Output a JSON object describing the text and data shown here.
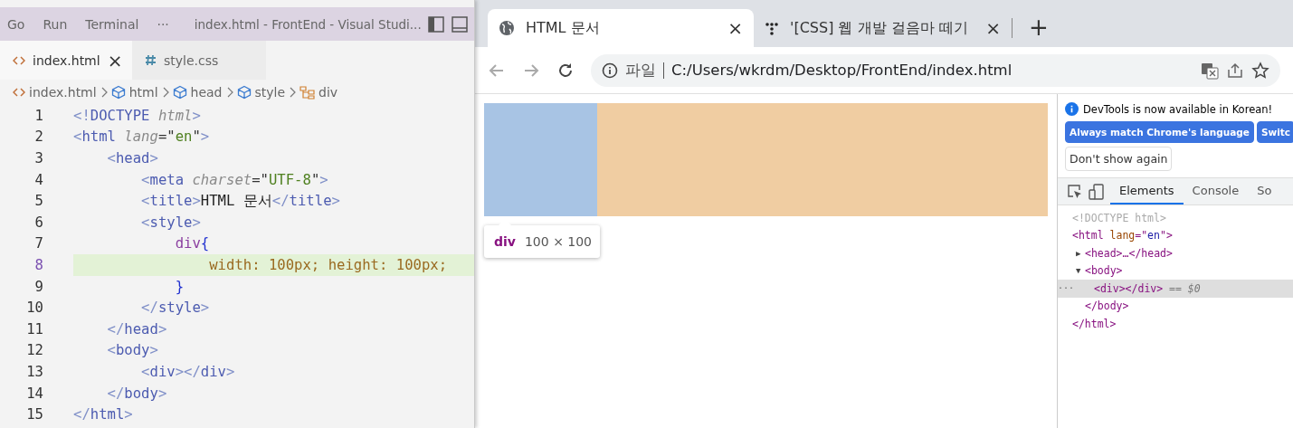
{
  "editor": {
    "menus": [
      "Go",
      "Run",
      "Terminal",
      "···"
    ],
    "title": "index.html - FrontEnd - Visual Studi...",
    "tabs": [
      {
        "label": "index.html",
        "kind": "html",
        "selected": true,
        "close": "×"
      },
      {
        "label": "style.css",
        "kind": "css",
        "selected": false
      }
    ],
    "breadcrumb": [
      {
        "label": "index.html",
        "kind": "file"
      },
      {
        "label": "html",
        "kind": "element"
      },
      {
        "label": "head",
        "kind": "element"
      },
      {
        "label": "style",
        "kind": "element"
      },
      {
        "label": "div",
        "kind": "rule"
      }
    ],
    "lines": [
      {
        "number": "1",
        "highlighted": false,
        "tokens": [
          {
            "kind": "punct",
            "text": "<!"
          },
          {
            "kind": "tag",
            "text": "DOCTYPE "
          },
          {
            "kind": "attr",
            "text": "html"
          },
          {
            "kind": "punct",
            "text": ">"
          }
        ]
      },
      {
        "number": "2",
        "highlighted": false,
        "tokens": [
          {
            "kind": "punct",
            "text": "<"
          },
          {
            "kind": "tag",
            "text": "html "
          },
          {
            "kind": "attr",
            "text": "lang"
          },
          {
            "kind": "plain",
            "text": "=\""
          },
          {
            "kind": "string",
            "text": "en"
          },
          {
            "kind": "plain",
            "text": "\""
          },
          {
            "kind": "punct",
            "text": ">"
          }
        ]
      },
      {
        "number": "3",
        "highlighted": false,
        "tokens": [
          {
            "kind": "punct",
            "text": "    <"
          },
          {
            "kind": "tag",
            "text": "head"
          },
          {
            "kind": "punct",
            "text": ">"
          }
        ]
      },
      {
        "number": "4",
        "highlighted": false,
        "tokens": [
          {
            "kind": "punct",
            "text": "        <"
          },
          {
            "kind": "tag",
            "text": "meta "
          },
          {
            "kind": "attr",
            "text": "charset"
          },
          {
            "kind": "plain",
            "text": "=\""
          },
          {
            "kind": "string",
            "text": "UTF-8"
          },
          {
            "kind": "plain",
            "text": "\""
          },
          {
            "kind": "punct",
            "text": ">"
          }
        ]
      },
      {
        "number": "5",
        "highlighted": false,
        "tokens": [
          {
            "kind": "punct",
            "text": "        <"
          },
          {
            "kind": "tag",
            "text": "title"
          },
          {
            "kind": "punct",
            "text": ">"
          },
          {
            "kind": "text",
            "text": "HTML 문서"
          },
          {
            "kind": "punct",
            "text": "</"
          },
          {
            "kind": "tag",
            "text": "title"
          },
          {
            "kind": "punct",
            "text": ">"
          }
        ]
      },
      {
        "number": "6",
        "highlighted": false,
        "tokens": [
          {
            "kind": "punct",
            "text": "        <"
          },
          {
            "kind": "tag",
            "text": "style"
          },
          {
            "kind": "punct",
            "text": ">"
          }
        ]
      },
      {
        "number": "7",
        "highlighted": false,
        "tokens": [
          {
            "kind": "selector",
            "text": "            div"
          },
          {
            "kind": "brace",
            "text": "{"
          }
        ]
      },
      {
        "number": "8",
        "highlighted": true,
        "tokens": [
          {
            "kind": "prop",
            "text": "                width: 100px; height: 100px;"
          }
        ]
      },
      {
        "number": "9",
        "highlighted": false,
        "tokens": [
          {
            "kind": "brace",
            "text": "            }"
          }
        ]
      },
      {
        "number": "10",
        "highlighted": false,
        "tokens": [
          {
            "kind": "punct",
            "text": "        </"
          },
          {
            "kind": "tag",
            "text": "style"
          },
          {
            "kind": "punct",
            "text": ">"
          }
        ]
      },
      {
        "number": "11",
        "highlighted": false,
        "tokens": [
          {
            "kind": "punct",
            "text": "    </"
          },
          {
            "kind": "tag",
            "text": "head"
          },
          {
            "kind": "punct",
            "text": ">"
          }
        ]
      },
      {
        "number": "12",
        "highlighted": false,
        "tokens": [
          {
            "kind": "punct",
            "text": "    <"
          },
          {
            "kind": "tag",
            "text": "body"
          },
          {
            "kind": "punct",
            "text": ">"
          }
        ]
      },
      {
        "number": "13",
        "highlighted": false,
        "tokens": [
          {
            "kind": "punct",
            "text": "        <"
          },
          {
            "kind": "tag",
            "text": "div"
          },
          {
            "kind": "punct",
            "text": "></"
          },
          {
            "kind": "tag",
            "text": "div"
          },
          {
            "kind": "punct",
            "text": ">"
          }
        ]
      },
      {
        "number": "14",
        "highlighted": false,
        "tokens": [
          {
            "kind": "punct",
            "text": "    </"
          },
          {
            "kind": "tag",
            "text": "body"
          },
          {
            "kind": "punct",
            "text": ">"
          }
        ]
      },
      {
        "number": "15",
        "highlighted": false,
        "tokens": [
          {
            "kind": "punct",
            "text": "</"
          },
          {
            "kind": "tag",
            "text": "html"
          },
          {
            "kind": "punct",
            "text": ">"
          }
        ]
      }
    ]
  },
  "browser": {
    "tabs": [
      {
        "title": "HTML 문서",
        "kind": "local",
        "selected": true,
        "close": "×"
      },
      {
        "title": "'[CSS] 웹 개발 걸음마 떼기",
        "kind": "site",
        "selected": false,
        "close": "×"
      }
    ],
    "new_tab": "+",
    "address": {
      "scheme_label": "파일",
      "url": "C:/Users/wkrdm/Desktop/FrontEnd/index.html"
    },
    "tooltip": {
      "tag": "div",
      "size": "100 × 100"
    },
    "devtools": {
      "notice": "DevTools is now available in Korean!",
      "buttons": [
        {
          "label": "Always match Chrome's language",
          "kind": "primary"
        },
        {
          "label": "Switc",
          "kind": "primary"
        },
        {
          "label": "Don't show again",
          "kind": "secondary"
        }
      ],
      "tabs": [
        {
          "label": "Elements",
          "selected": true
        },
        {
          "label": "Console",
          "selected": false
        },
        {
          "label": "So",
          "selected": false
        }
      ],
      "tree": [
        {
          "selected": false,
          "tokens": [
            {
              "kind": "doctype",
              "text": "<!DOCTYPE html>"
            }
          ]
        },
        {
          "selected": false,
          "tokens": [
            {
              "kind": "tag",
              "text": "<html "
            },
            {
              "kind": "attr",
              "text": "lang"
            },
            {
              "kind": "tag",
              "text": "=\""
            },
            {
              "kind": "value",
              "text": "en"
            },
            {
              "kind": "tag",
              "text": "\">"
            }
          ]
        },
        {
          "selected": false,
          "arrow": "▶",
          "tokens": [
            {
              "kind": "tag",
              "text": "<head>…</head>"
            }
          ]
        },
        {
          "selected": false,
          "arrow": "▼",
          "tokens": [
            {
              "kind": "tag",
              "text": "<body>"
            }
          ]
        },
        {
          "selected": true,
          "more": "···",
          "tokens": [
            {
              "kind": "tag",
              "text": "<div></div>"
            },
            {
              "kind": "ref",
              "text": " == $0"
            }
          ]
        },
        {
          "selected": false,
          "tokens": [
            {
              "kind": "tag",
              "text": "</body>"
            }
          ]
        },
        {
          "selected": false,
          "tokens": [
            {
              "kind": "tag",
              "text": "</html>"
            }
          ]
        }
      ]
    }
  }
}
